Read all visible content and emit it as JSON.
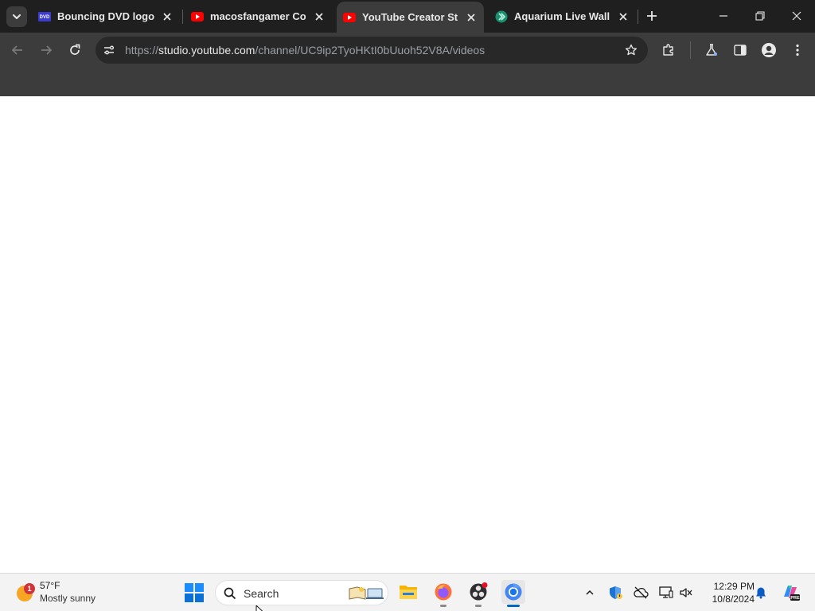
{
  "browser": {
    "tabs": [
      {
        "title": "Bouncing DVD logo",
        "icon": "dvd-logo-icon",
        "active": false
      },
      {
        "title": "macosfangamer Colla",
        "icon": "youtube-icon",
        "active": false
      },
      {
        "title": "YouTube Creator Studi",
        "icon": "youtube-icon",
        "active": true
      },
      {
        "title": "Aquarium Live Wallpa",
        "icon": "aquarium-app-icon",
        "active": false
      }
    ],
    "url": {
      "scheme": "https://",
      "host": "studio.youtube.com",
      "path": "/channel/UC9ip2TyoHKtI0bUuoh52V8A/videos"
    },
    "colors": {
      "tabstrip": "#1f1f1f",
      "toolbar": "#3c3c3c",
      "omnibox": "#282828",
      "youtube_red": "#ff0000"
    }
  },
  "taskbar": {
    "weather": {
      "badge": "1",
      "temp": "57°F",
      "condition": "Mostly sunny"
    },
    "search": {
      "label": "Search"
    },
    "apps": [
      "file-explorer-icon",
      "firefox-icon",
      "obs-icon",
      "chrome-icon"
    ],
    "tray": [
      "chevron-up-icon",
      "defender-icon",
      "onedrive-offline-icon",
      "network-icon",
      "volume-icon"
    ],
    "clock": {
      "time": "12:29 PM",
      "date": "10/8/2024"
    }
  }
}
